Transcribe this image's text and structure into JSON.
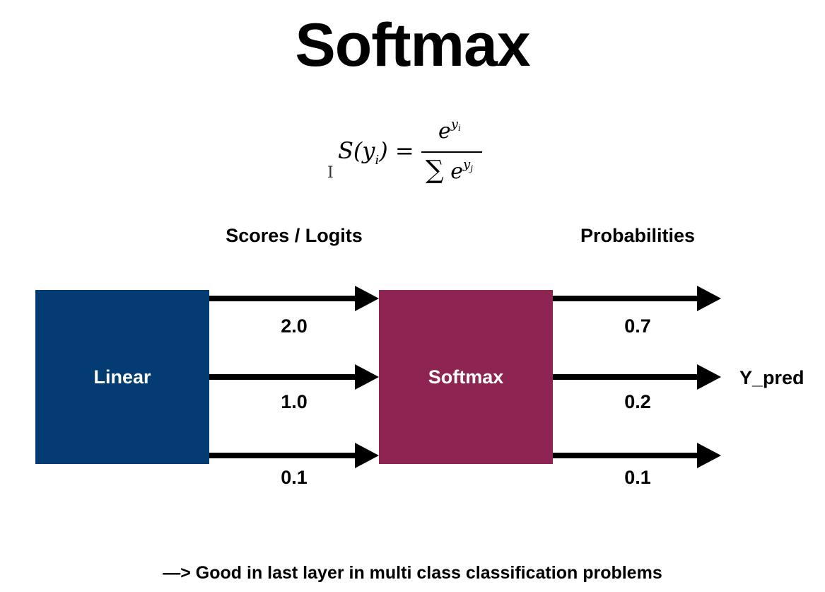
{
  "title": "Softmax",
  "formula": {
    "lhs": "S(y",
    "lhs_sub": "i",
    "lhs_close": ") =",
    "num_base": "e",
    "num_sup": "y",
    "num_sup_sub": "i",
    "den_sigma": "∑",
    "den_base": "e",
    "den_sup": "y",
    "den_sup_sub": "j"
  },
  "headers": {
    "scores": "Scores / Logits",
    "probabilities": "Probabilities"
  },
  "boxes": {
    "linear": "Linear",
    "softmax": "Softmax"
  },
  "scores": [
    "2.0",
    "1.0",
    "0.1"
  ],
  "probabilities": [
    "0.7",
    "0.2",
    "0.1"
  ],
  "output_label": "Y_pred",
  "footer": "—> Good in last layer in multi class classification problems",
  "colors": {
    "linear": "#033b73",
    "softmax": "#8e2451"
  }
}
